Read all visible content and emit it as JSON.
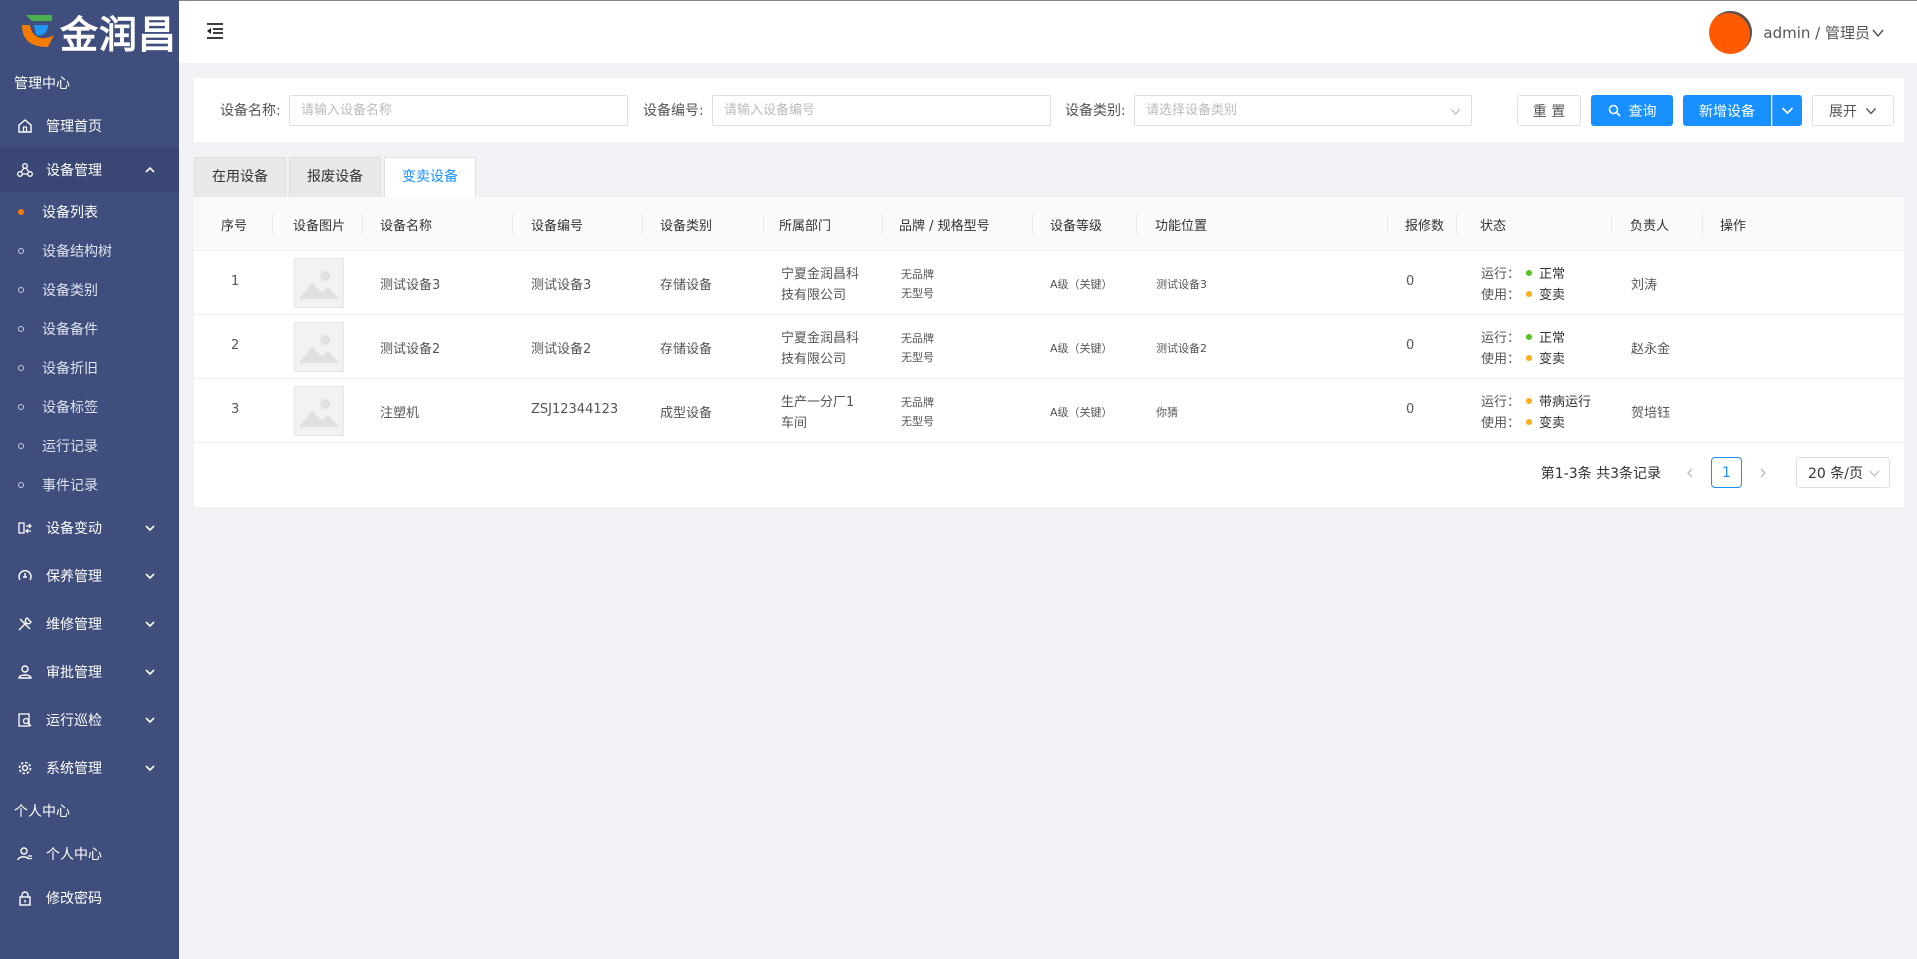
{
  "brand": {
    "name": "金润昌"
  },
  "sidebar": {
    "section_manage": "管理中心",
    "home": "管理首页",
    "device_manage": "设备管理",
    "sub_items": [
      "设备列表",
      "设备结构树",
      "设备类别",
      "设备备件",
      "设备折旧",
      "设备标签",
      "运行记录",
      "事件记录"
    ],
    "groups": [
      "设备变动",
      "保养管理",
      "维修管理",
      "审批管理",
      "运行巡检",
      "系统管理"
    ],
    "section_personal": "个人中心",
    "personal": "个人中心",
    "change_password": "修改密码"
  },
  "header": {
    "user": "admin / 管理员"
  },
  "filters": {
    "name_label": "设备名称:",
    "name_placeholder": "请输入设备名称",
    "code_label": "设备编号:",
    "code_placeholder": "请输入设备编号",
    "category_label": "设备类别:",
    "category_placeholder": "请选择设备类别",
    "reset": "重 置",
    "search": "查询",
    "add": "新增设备",
    "expand": "展开"
  },
  "tabs": [
    "在用设备",
    "报废设备",
    "变卖设备"
  ],
  "table": {
    "columns": [
      "序号",
      "设备图片",
      "设备名称",
      "设备编号",
      "设备类别",
      "所属部门",
      "品牌 / 规格型号",
      "设备等级",
      "功能位置",
      "报修数",
      "状态",
      "负责人",
      "操作"
    ],
    "rows": [
      {
        "no": "1",
        "name": "测试设备3",
        "code": "测试设备3",
        "category": "存储设备",
        "dept1": "宁夏金润昌科",
        "dept2": "技有限公司",
        "brand": "无品牌",
        "model": "无型号",
        "level": "A级（关键）",
        "location": "测试设备3",
        "repairs": "0",
        "run_label": "运行：",
        "run": "正常",
        "use_label": "使用：",
        "use": "变卖",
        "owner": "刘涛"
      },
      {
        "no": "2",
        "name": "测试设备2",
        "code": "测试设备2",
        "category": "存储设备",
        "dept1": "宁夏金润昌科",
        "dept2": "技有限公司",
        "brand": "无品牌",
        "model": "无型号",
        "level": "A级（关键）",
        "location": "测试设备2",
        "repairs": "0",
        "run_label": "运行：",
        "run": "正常",
        "use_label": "使用：",
        "use": "变卖",
        "owner": "赵永金"
      },
      {
        "no": "3",
        "name": "注塑机",
        "code": "ZSJ12344123",
        "category": "成型设备",
        "dept1": "生产一分厂1",
        "dept2": "车间",
        "brand": "无品牌",
        "model": "无型号",
        "level": "A级（关键）",
        "location": "你猜",
        "repairs": "0",
        "run_label": "运行：",
        "run": "带病运行",
        "use_label": "使用：",
        "use": "变卖",
        "owner": "贺培钰"
      }
    ]
  },
  "pagination": {
    "total_text": "第1-3条 共3条记录",
    "current": "1",
    "page_size": "20 条/页"
  },
  "colors": {
    "sidebar": "#3f4e7d",
    "primary": "#1890ff",
    "status_green": "#52c41a",
    "status_orange": "#faad14",
    "active_dot": "#f57c00"
  }
}
